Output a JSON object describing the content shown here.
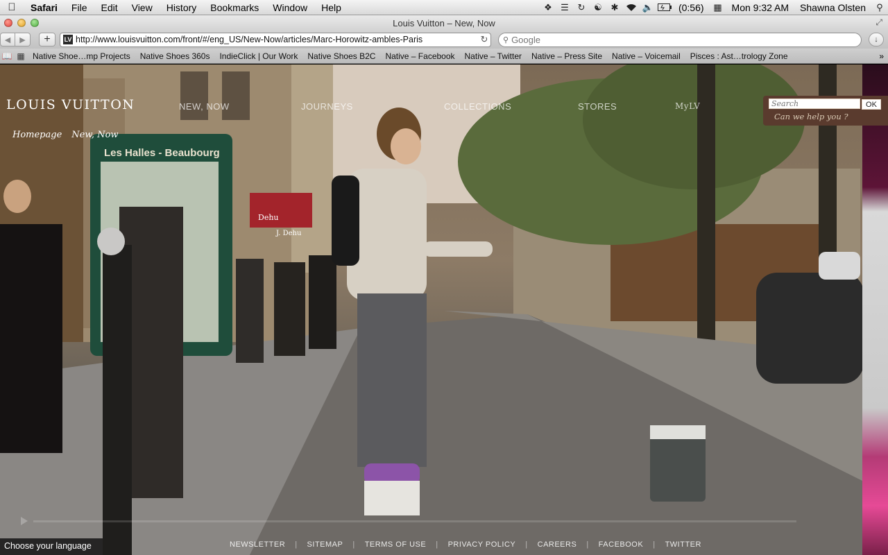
{
  "menubar": {
    "app": "Safari",
    "items": [
      "File",
      "Edit",
      "View",
      "History",
      "Bookmarks",
      "Window",
      "Help"
    ],
    "battery": "(0:56)",
    "clock": "Mon 9:32 AM",
    "user": "Shawna Olsten"
  },
  "window": {
    "title": "Louis Vuitton – New, Now"
  },
  "toolbar": {
    "url": "http://www.louisvuitton.com/front/#/eng_US/New-Now/articles/Marc-Horowitz-ambles-Paris",
    "search_placeholder": "Google"
  },
  "bookmarks": [
    "Native Shoe…mp Projects",
    "Native Shoes 360s",
    "IndieClick | Our Work",
    "Native Shoes B2C",
    "Native – Facebook",
    "Native – Twitter",
    "Native – Press Site",
    "Native – Voicemail",
    "Pisces : Ast…trology Zone"
  ],
  "site": {
    "logo": "LOUIS VUITTON",
    "nav": [
      "NEW, NOW",
      "JOURNEYS",
      "COLLECTIONS",
      "STORES"
    ],
    "my_lv": "MyLV",
    "breadcrumb": [
      "Homepage",
      "New, Now"
    ],
    "search_placeholder": "Search",
    "search_button": "OK",
    "help": "Can we help you ?",
    "footer": [
      "NEWSLETTER",
      "SITEMAP",
      "TERMS OF USE",
      "PRIVACY POLICY",
      "CAREERS",
      "FACEBOOK",
      "TWITTER"
    ],
    "language": "Choose your language",
    "sign_text": "Les Halles - Beaubourg",
    "shop_sign_1": "Dehu",
    "shop_sign_2": "J. Dehu"
  }
}
